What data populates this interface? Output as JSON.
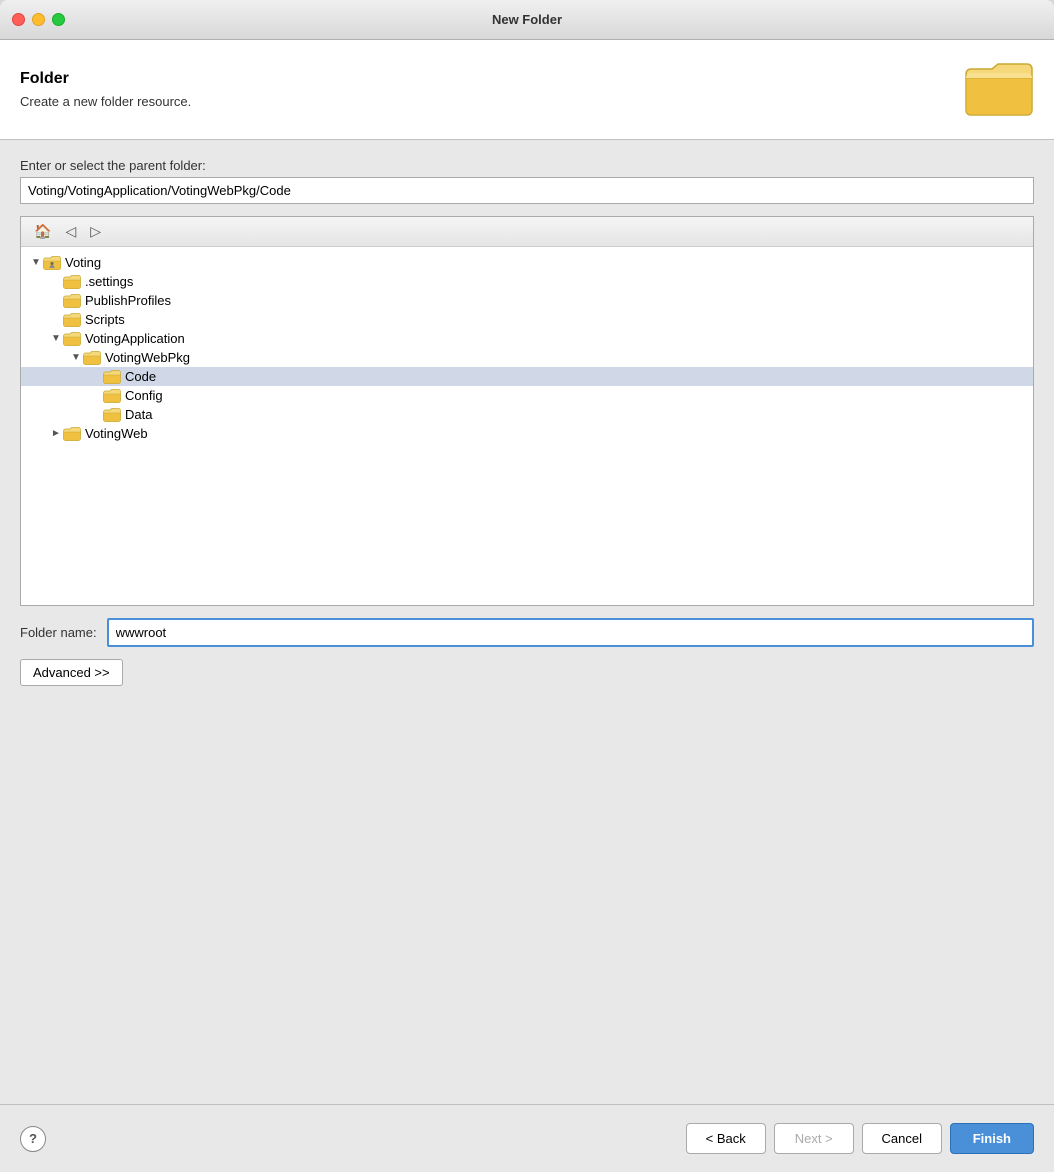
{
  "titlebar": {
    "title": "New Folder"
  },
  "header": {
    "title": "Folder",
    "subtitle": "Create a new folder resource."
  },
  "form": {
    "parent_folder_label": "Enter or select the parent folder:",
    "parent_folder_value": "Voting/VotingApplication/VotingWebPkg/Code",
    "folder_name_label": "Folder name:",
    "folder_name_value": "wwwroot"
  },
  "tree": {
    "items": [
      {
        "id": "voting",
        "label": "Voting",
        "indent": 0,
        "expanded": true,
        "type": "project",
        "toggle": "▼"
      },
      {
        "id": "settings",
        "label": ".settings",
        "indent": 1,
        "expanded": false,
        "type": "folder",
        "toggle": ""
      },
      {
        "id": "publishprofiles",
        "label": "PublishProfiles",
        "indent": 1,
        "expanded": false,
        "type": "folder",
        "toggle": ""
      },
      {
        "id": "scripts",
        "label": "Scripts",
        "indent": 1,
        "expanded": false,
        "type": "folder",
        "toggle": ""
      },
      {
        "id": "votingapplication",
        "label": "VotingApplication",
        "indent": 1,
        "expanded": true,
        "type": "folder",
        "toggle": "▼"
      },
      {
        "id": "votingwebpkg",
        "label": "VotingWebPkg",
        "indent": 2,
        "expanded": true,
        "type": "folder",
        "toggle": "▼"
      },
      {
        "id": "code",
        "label": "Code",
        "indent": 3,
        "expanded": false,
        "type": "folder",
        "toggle": "",
        "selected": true
      },
      {
        "id": "config",
        "label": "Config",
        "indent": 3,
        "expanded": false,
        "type": "folder",
        "toggle": ""
      },
      {
        "id": "data",
        "label": "Data",
        "indent": 3,
        "expanded": false,
        "type": "folder",
        "toggle": ""
      },
      {
        "id": "votingweb",
        "label": "VotingWeb",
        "indent": 1,
        "expanded": false,
        "type": "folder",
        "toggle": "►"
      }
    ]
  },
  "buttons": {
    "advanced": "Advanced >>",
    "back": "< Back",
    "next": "Next >",
    "cancel": "Cancel",
    "finish": "Finish",
    "help": "?"
  },
  "colors": {
    "accent": "#4a90d9",
    "selected_bg": "#d0d8e8"
  }
}
